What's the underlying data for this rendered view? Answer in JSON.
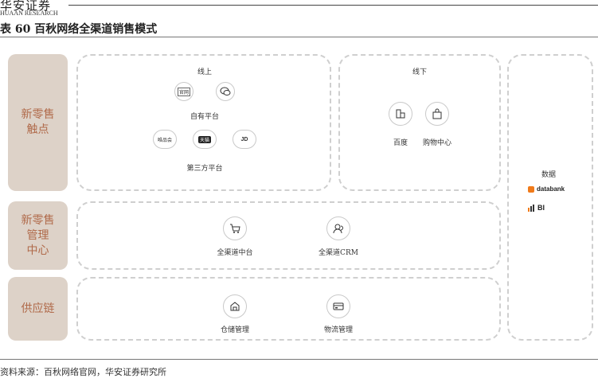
{
  "header": {
    "logo": "华安证券",
    "logo_sub": "HUAAN RESEARCH",
    "figure_title": "表 60 百秋网络全渠道销售模式",
    "source": "资料来源：百秋网络官网，华安证券研究所"
  },
  "categories": [
    "新零售\n触点",
    "新零售\n管理\n中心",
    "供应链"
  ],
  "online": {
    "title": "线上",
    "own_platform_label": "自有平台",
    "official_site_text": "官网",
    "third_party_label": "第三方平台",
    "third_party_logos": [
      "唯品会",
      "天猫",
      "JD"
    ]
  },
  "offline": {
    "title": "线下",
    "labels": [
      "百度",
      "购物中心"
    ]
  },
  "data_panel": {
    "title": "数据",
    "brands": [
      "databank",
      "BI"
    ]
  },
  "management": {
    "labels": [
      "全渠道中台",
      "全渠道CRM"
    ]
  },
  "supply_chain": {
    "labels": [
      "仓储管理",
      "物流管理"
    ]
  }
}
